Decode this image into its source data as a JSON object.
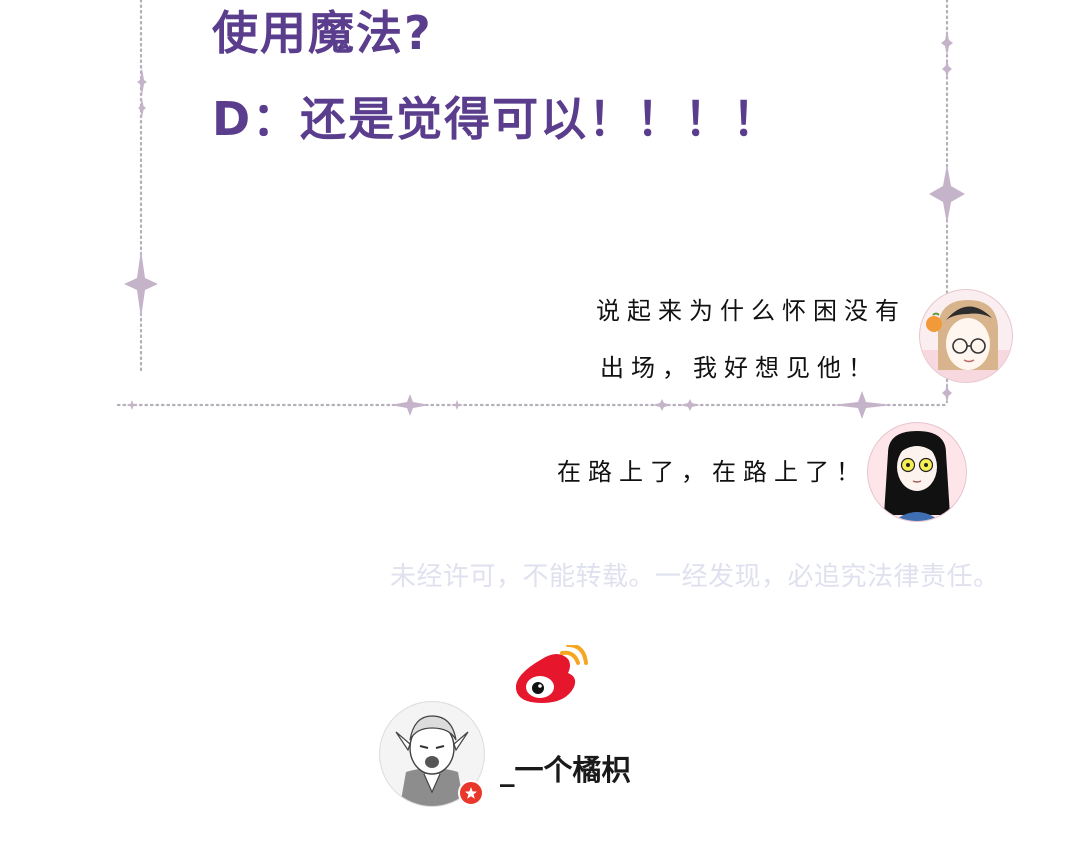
{
  "dialogue": {
    "line1": "使用魔法?",
    "line2": "D：还是觉得可以！！！！"
  },
  "chat": {
    "message1_line1": "说起来为什么怀困没有",
    "message1_line2": "出场，我好想见他！",
    "message2": "在路上了，在路上了！"
  },
  "watermark": "未经许可，不能转载。一经发现，必追究法律责任。",
  "author": {
    "name": "_一个橘枳",
    "platform_icon": "weibo-icon"
  },
  "colors": {
    "dialogue_text": "#5a3d8c",
    "frame_dots": "#b4aeb8",
    "sparkle": "#c5b4c9",
    "watermark": "#dfe1ef",
    "weibo_red": "#e6162d",
    "weibo_orange": "#f5a623"
  }
}
